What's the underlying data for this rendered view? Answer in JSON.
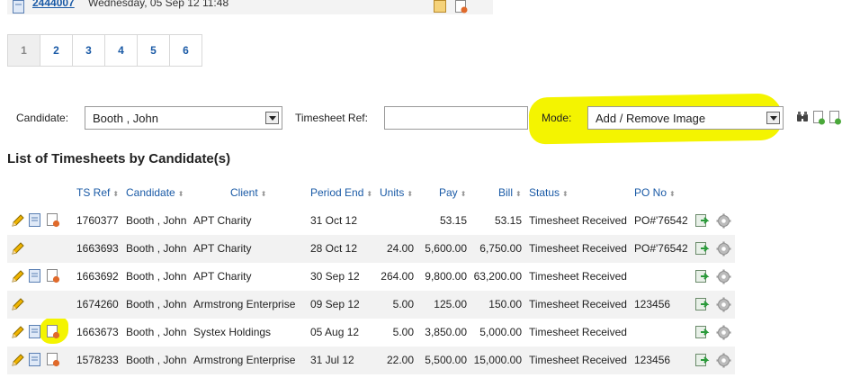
{
  "top_item": {
    "ref": "2444007",
    "date": "Wednesday, 05 Sep 12 11:48"
  },
  "pagination": [
    "1",
    "2",
    "3",
    "4",
    "5",
    "6"
  ],
  "filters": {
    "candidate_label": "Candidate:",
    "candidate_value": "Booth , John",
    "timesheet_ref_label": "Timesheet Ref:",
    "timesheet_ref_value": "",
    "mode_label": "Mode:",
    "mode_value": "Add / Remove Image"
  },
  "section_title": "List of Timesheets by Candidate(s)",
  "columns": {
    "ts_ref": "TS Ref",
    "candidate": "Candidate",
    "client": "Client",
    "period_end": "Period End",
    "units": "Units",
    "pay": "Pay",
    "bill": "Bill",
    "status": "Status",
    "po_no": "PO No"
  },
  "rows": [
    {
      "ts_ref": "1760377",
      "candidate": "Booth , John",
      "client": "APT Charity",
      "period_end": "31 Oct 12",
      "units": "",
      "pay": "53.15",
      "bill": "53.15",
      "status": "Timesheet Received",
      "po_no": "PO#'76542"
    },
    {
      "ts_ref": "1663693",
      "candidate": "Booth , John",
      "client": "APT Charity",
      "period_end": "28 Oct 12",
      "units": "24.00",
      "pay": "5,600.00",
      "bill": "6,750.00",
      "status": "Timesheet Received",
      "po_no": "PO#'76542"
    },
    {
      "ts_ref": "1663692",
      "candidate": "Booth , John",
      "client": "APT Charity",
      "period_end": "30 Sep 12",
      "units": "264.00",
      "pay": "9,800.00",
      "bill": "63,200.00",
      "status": "Timesheet Received",
      "po_no": ""
    },
    {
      "ts_ref": "1674260",
      "candidate": "Booth , John",
      "client": "Armstrong Enterprise",
      "period_end": "09 Sep 12",
      "units": "5.00",
      "pay": "125.00",
      "bill": "150.00",
      "status": "Timesheet Received",
      "po_no": "123456"
    },
    {
      "ts_ref": "1663673",
      "candidate": "Booth , John",
      "client": "Systex Holdings",
      "period_end": "05 Aug 12",
      "units": "5.00",
      "pay": "3,850.00",
      "bill": "5,000.00",
      "status": "Timesheet Received",
      "po_no": ""
    },
    {
      "ts_ref": "1578233",
      "candidate": "Booth , John",
      "client": "Armstrong Enterprise",
      "period_end": "31 Jul 12",
      "units": "22.00",
      "pay": "5,500.00",
      "bill": "15,000.00",
      "status": "Timesheet Received",
      "po_no": "123456"
    }
  ],
  "icons": {
    "edit": "pencil-icon",
    "document": "document-icon",
    "image": "image-icon",
    "export": "export-icon",
    "settings": "gear-icon",
    "search": "binoculars-icon",
    "add": "add-document-icon"
  },
  "colors": {
    "link": "#1a5aa6",
    "highlight": "#f4f400",
    "alt_row": "#f2f2f2"
  }
}
